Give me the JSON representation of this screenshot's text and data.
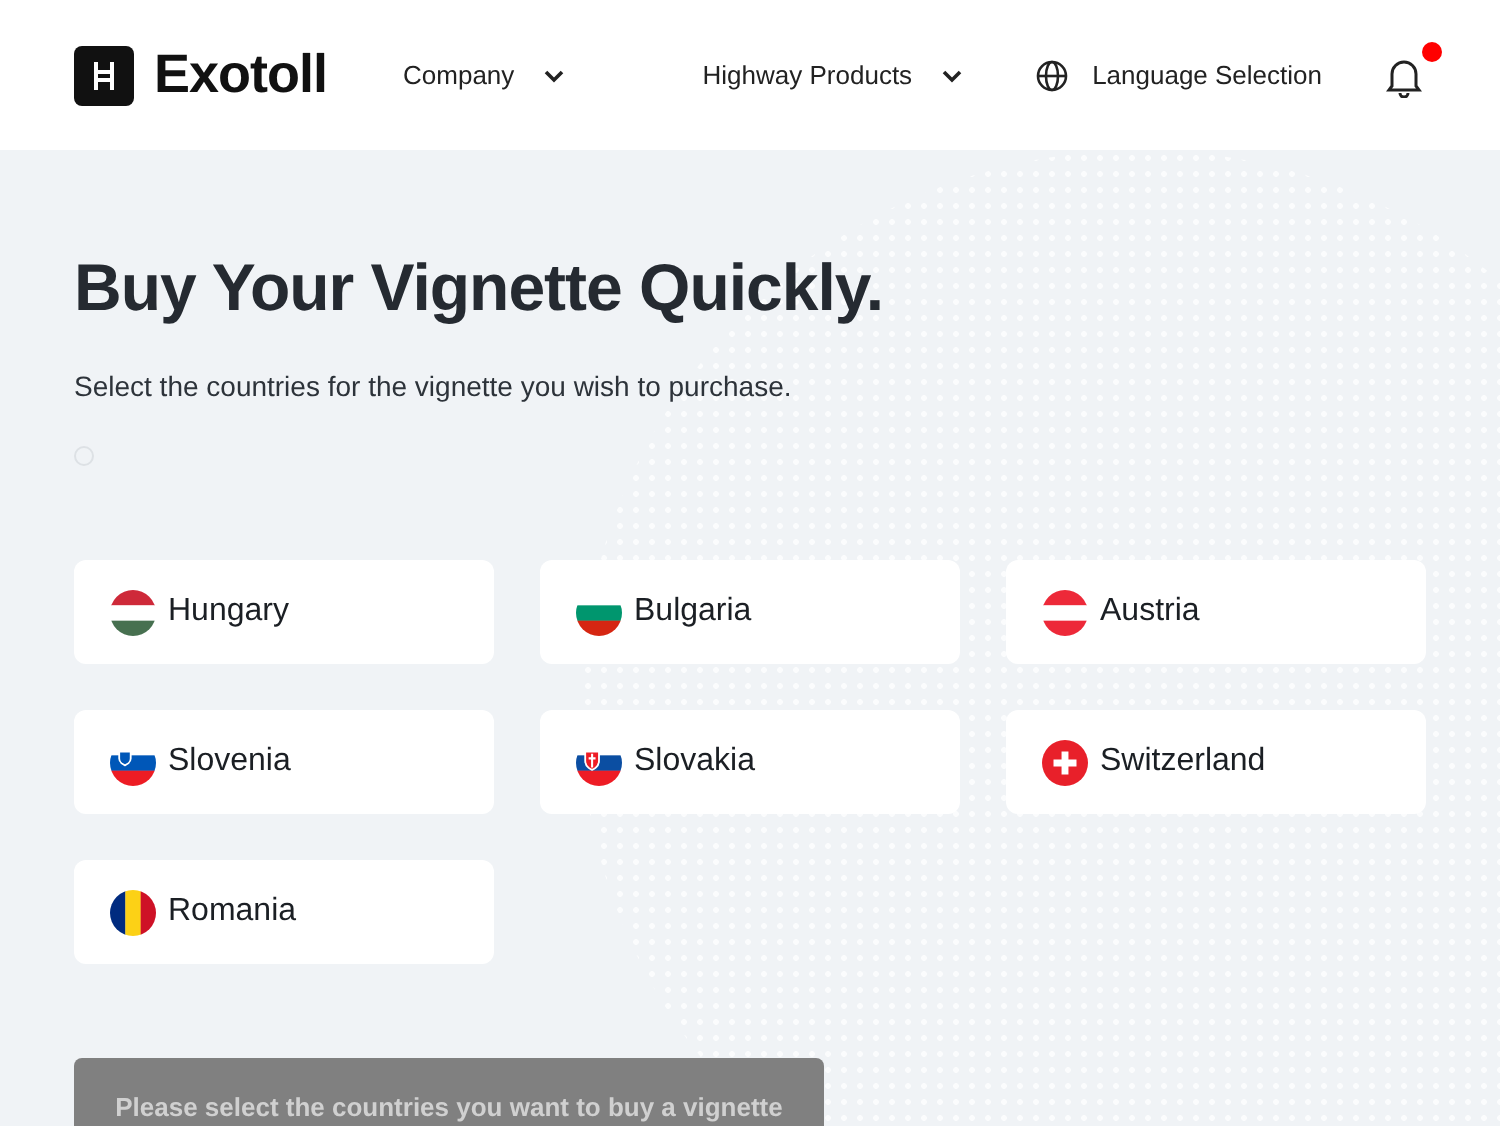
{
  "header": {
    "logo_text": "Exotoll",
    "nav": [
      {
        "label": "Company",
        "kind": "dropdown"
      },
      {
        "label": "Highway Products",
        "kind": "dropdown"
      },
      {
        "label": "Language Selection",
        "kind": "language"
      }
    ],
    "notification": {
      "unread": true
    }
  },
  "hero": {
    "title": "Buy Your Vignette Quickly.",
    "subtitle": "Select the countries for the vignette you wish to purchase."
  },
  "countries": [
    {
      "name": "Hungary",
      "kind": "hungary"
    },
    {
      "name": "Bulgaria",
      "kind": "bulgaria"
    },
    {
      "name": "Austria",
      "kind": "austria"
    },
    {
      "name": "Slovenia",
      "kind": "slovenia"
    },
    {
      "name": "Slovakia",
      "kind": "slovakia"
    },
    {
      "name": "Switzerland",
      "kind": "switzerland"
    },
    {
      "name": "Romania",
      "kind": "romania"
    }
  ],
  "submit": {
    "label": "Please select the countries you want to buy a vignette",
    "disabled": true
  }
}
